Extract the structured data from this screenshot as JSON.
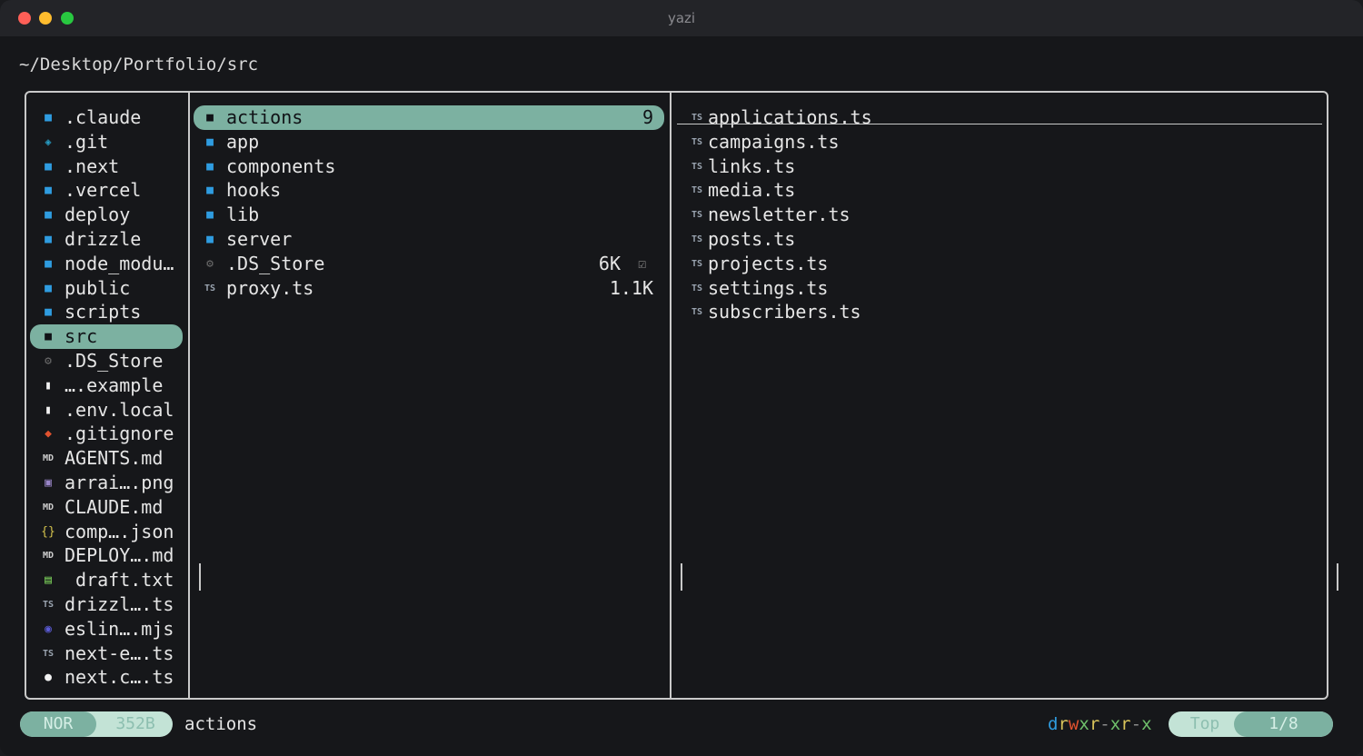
{
  "window": {
    "title": "yazi"
  },
  "cwd": "~/Desktop/Portfolio/src",
  "parent_pane": {
    "items": [
      {
        "name": ".claude",
        "icon": "folder-icon"
      },
      {
        "name": ".git",
        "icon": "git-folder-icon"
      },
      {
        "name": ".next",
        "icon": "folder-icon"
      },
      {
        "name": ".vercel",
        "icon": "folder-icon"
      },
      {
        "name": "deploy",
        "icon": "folder-icon"
      },
      {
        "name": "drizzle",
        "icon": "folder-icon"
      },
      {
        "name": "node_modu…",
        "icon": "folder-icon"
      },
      {
        "name": "public",
        "icon": "folder-icon"
      },
      {
        "name": "scripts",
        "icon": "folder-icon"
      },
      {
        "name": "src",
        "icon": "folder-open-icon",
        "selected": true
      },
      {
        "name": ".DS_Store",
        "icon": "gear-icon"
      },
      {
        "name": "….example",
        "icon": "file-icon"
      },
      {
        "name": ".env.local",
        "icon": "file-icon"
      },
      {
        "name": ".gitignore",
        "icon": "git-icon"
      },
      {
        "name": "AGENTS.md",
        "icon": "markdown-icon"
      },
      {
        "name": "arrai….png",
        "icon": "image-icon"
      },
      {
        "name": "CLAUDE.md",
        "icon": "markdown-icon"
      },
      {
        "name": "comp….json",
        "icon": "json-icon"
      },
      {
        "name": "DEPLOY….md",
        "icon": "markdown-icon"
      },
      {
        "name": " draft.txt",
        "icon": "text-file-icon"
      },
      {
        "name": "drizzl….ts",
        "icon": "typescript-icon"
      },
      {
        "name": "eslin….mjs",
        "icon": "eslint-icon"
      },
      {
        "name": "next-e….ts",
        "icon": "typescript-icon"
      },
      {
        "name": "next.c….ts",
        "icon": "nextjs-icon"
      }
    ]
  },
  "current_pane": {
    "items": [
      {
        "name": "actions",
        "icon": "folder-open-icon",
        "size": "9",
        "selected": true
      },
      {
        "name": "app",
        "icon": "folder-icon",
        "size": ""
      },
      {
        "name": "components",
        "icon": "folder-icon",
        "size": ""
      },
      {
        "name": "hooks",
        "icon": "folder-icon",
        "size": ""
      },
      {
        "name": "lib",
        "icon": "folder-icon",
        "size": ""
      },
      {
        "name": "server",
        "icon": "folder-icon",
        "size": ""
      },
      {
        "name": ".DS_Store",
        "icon": "gear-icon",
        "size": "6K",
        "flag": "☑"
      },
      {
        "name": "proxy.ts",
        "icon": "typescript-icon",
        "size": "1.1K"
      }
    ]
  },
  "preview_pane": {
    "items": [
      {
        "name": "applications.ts",
        "icon": "typescript-icon",
        "hovered": true
      },
      {
        "name": "campaigns.ts",
        "icon": "typescript-icon"
      },
      {
        "name": "links.ts",
        "icon": "typescript-icon"
      },
      {
        "name": "media.ts",
        "icon": "typescript-icon"
      },
      {
        "name": "newsletter.ts",
        "icon": "typescript-icon"
      },
      {
        "name": "posts.ts",
        "icon": "typescript-icon"
      },
      {
        "name": "projects.ts",
        "icon": "typescript-icon"
      },
      {
        "name": "settings.ts",
        "icon": "typescript-icon"
      },
      {
        "name": "subscribers.ts",
        "icon": "typescript-icon"
      }
    ]
  },
  "status": {
    "mode": "NOR",
    "size": "352B",
    "name": "actions",
    "permissions": "drwxr-xr-x",
    "position": "Top",
    "count": "1/8"
  },
  "colors": {
    "accent": "#7cb1a1",
    "accent_light": "#c3e3d6",
    "folder": "#2f9ce0",
    "background": "#16171a"
  }
}
